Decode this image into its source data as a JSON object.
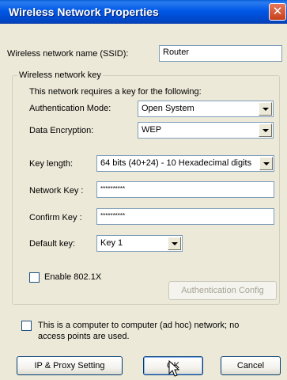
{
  "window": {
    "title": "Wireless Network Properties",
    "close_glyph": "✕"
  },
  "ssid": {
    "label": "Wireless network name (SSID):",
    "value": "Router"
  },
  "group": {
    "legend": "Wireless network key",
    "description": "This network requires a key for the following:",
    "auth_mode": {
      "label": "Authentication Mode:",
      "value": "Open System"
    },
    "encryption": {
      "label": "Data Encryption:",
      "value": "WEP"
    },
    "key_length": {
      "label": "Key length:",
      "value": "64 bits (40+24) - 10 Hexadecimal digits"
    },
    "network_key": {
      "label": "Network Key :",
      "value": "**********"
    },
    "confirm_key": {
      "label": "Confirm Key :",
      "value": "**********"
    },
    "default_key": {
      "label": "Default key:",
      "value": "Key 1"
    },
    "enable_8021x": {
      "label": "Enable 802.1X",
      "checked": false
    },
    "auth_config_label": "Authentication Config"
  },
  "adhoc": {
    "line1": "This is a computer to computer (ad hoc) network; no",
    "line2": "access points are used.",
    "checked": false
  },
  "buttons": {
    "ip_proxy": "IP & Proxy Setting",
    "ok": "OK",
    "cancel": "Cancel"
  },
  "icons": {
    "close": "close-icon",
    "cursor": "mouse-pointer-icon",
    "dropdown": "chevron-down-icon"
  }
}
